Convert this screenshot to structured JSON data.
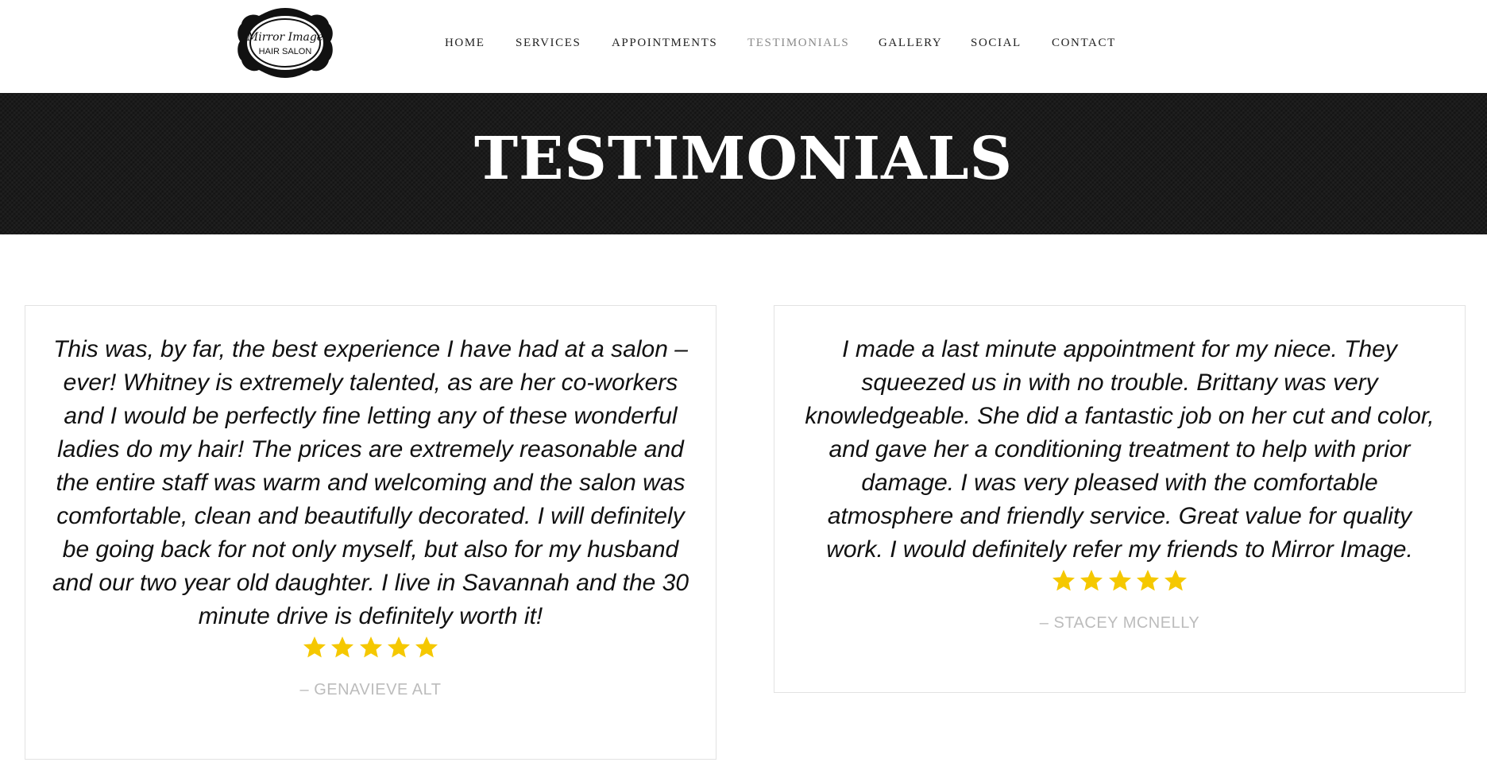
{
  "brand": {
    "logo_line1": "Mirror Image",
    "logo_line2": "HAIR SALON"
  },
  "nav": {
    "items": [
      {
        "label": "HOME"
      },
      {
        "label": "SERVICES"
      },
      {
        "label": "APPOINTMENTS"
      },
      {
        "label": "TESTIMONIALS",
        "active": true
      },
      {
        "label": "GALLERY"
      },
      {
        "label": "SOCIAL"
      },
      {
        "label": "CONTACT"
      }
    ]
  },
  "banner": {
    "title": "TESTIMONIALS"
  },
  "testimonials": [
    {
      "quote": "This was, by far, the best experience I have had at a salon – ever! Whitney is extremely talented, as are her co-workers and I would be perfectly fine letting any of these wonderful ladies do my hair! The prices are extremely reasonable and the entire staff was warm and welcoming and the salon was comfortable, clean and beautifully decorated. I will definitely be going back for not only myself, but also for my husband and our two year old daughter. I live in Savannah and the 30 minute drive is definitely worth it!",
      "rating": 5,
      "author": "– GENAVIEVE ALT"
    },
    {
      "quote": "I made a last minute appointment for my niece. They squeezed us in with no trouble. Brittany was very knowledgeable. She did a fantastic job on her cut and color, and gave her a conditioning treatment to help with prior damage. I was very pleased with the comfortable atmosphere and friendly service. Great value for quality work. I would definitely refer my friends to Mirror Image.",
      "rating": 5,
      "author": "– STACEY MCNELLY"
    }
  ],
  "colors": {
    "star": "#f5c800",
    "banner_bg": "#1b1b1b",
    "nav_active": "#8a8a8a",
    "author": "#bcbcbc"
  }
}
